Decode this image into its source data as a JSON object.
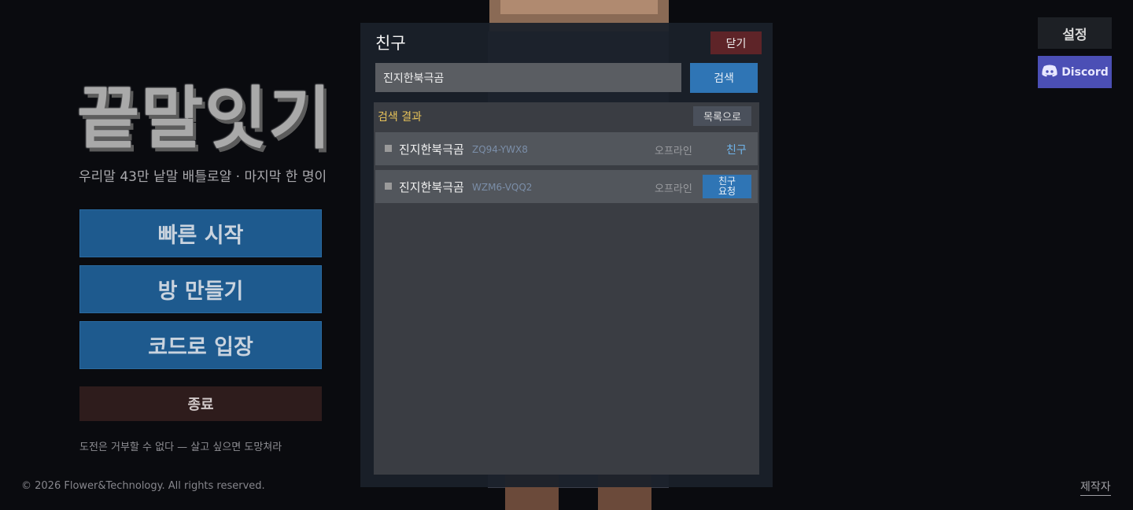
{
  "menu": {
    "logo": "끝말잇기",
    "tagline": "우리말 43만 낱말 배틀로얄 · 마지막 한 명이",
    "quick_start": "빠른 시작",
    "create_room": "방 만들기",
    "join_code": "코드로 입장",
    "exit": "종료",
    "motto": "도전은 거부할 수 없다 — 살고 싶으면 도망쳐라"
  },
  "footer": {
    "copyright": "© 2026 Flower&Technology. All rights reserved.",
    "credits": "제작자"
  },
  "topright": {
    "settings": "설정",
    "discord": "Discord"
  },
  "friends_modal": {
    "title": "친구",
    "close": "닫기",
    "search_value": "진지한북극곰",
    "search_button": "검색",
    "results_label": "검색 결과",
    "back_to_list": "목록으로",
    "results": [
      {
        "name": "진지한북극곰",
        "code": "ZQ94-YWX8",
        "status": "오프라인",
        "action": "친구"
      },
      {
        "name": "진지한북극곰",
        "code": "WZM6-VQQ2",
        "status": "오프라인",
        "action": "친구\n요청"
      }
    ]
  },
  "colors": {
    "primary_button": "#1e5a8e",
    "modal_accent": "#2f75b5",
    "close_red": "#5e2428",
    "discord": "#4b4fb5",
    "results_label": "#e8c35a"
  }
}
